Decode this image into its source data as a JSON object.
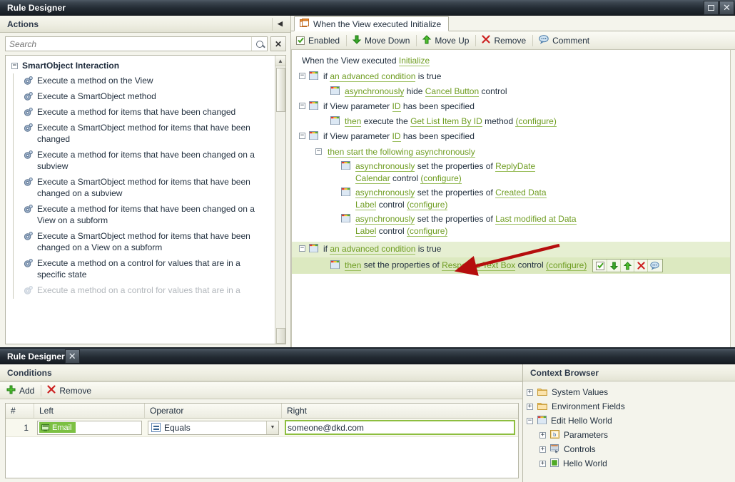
{
  "window": {
    "title": "Rule Designer",
    "maximize_icon": "maximize-icon",
    "close_icon": "close-icon"
  },
  "actions_panel": {
    "header": "Actions",
    "collapse_icon": "collapse-left-icon",
    "search": {
      "placeholder": "Search",
      "value": "",
      "search_icon": "search-icon",
      "clear_icon": "clear-icon"
    },
    "group": {
      "label": "SmartObject Interaction",
      "expander": "−"
    },
    "items": [
      {
        "label": "Execute a method on the View",
        "icon": "gear-icon"
      },
      {
        "label": "Execute a SmartObject method",
        "icon": "gear-icon"
      },
      {
        "label": "Execute a method for items that have been changed",
        "icon": "gear-icon"
      },
      {
        "label": "Execute a SmartObject method for items that have been changed",
        "icon": "gear-icon"
      },
      {
        "label": "Execute a method for items that have been changed on a subview",
        "icon": "gear-icon"
      },
      {
        "label": "Execute a SmartObject method for items that have been changed on a subview",
        "icon": "gear-icon"
      },
      {
        "label": "Execute a method for items that have been changed on a View on a subform",
        "icon": "gear-icon"
      },
      {
        "label": "Execute a SmartObject method for items that have been changed on a View on a subform",
        "icon": "gear-icon"
      },
      {
        "label": "Execute a method on a control for values that are in a specific state",
        "icon": "gear-icon"
      },
      {
        "label": "Execute a method on a control for values that are in a",
        "icon": "gear-icon"
      }
    ]
  },
  "rule_panel": {
    "tab": {
      "label": "When the View executed Initialize",
      "icon": "rule-tab-icon"
    },
    "toolbar": [
      {
        "label": "Enabled",
        "icon": "checkbox-checked-icon"
      },
      {
        "label": "Move Down",
        "icon": "arrow-down-icon"
      },
      {
        "label": "Move Up",
        "icon": "arrow-up-icon"
      },
      {
        "label": "Remove",
        "icon": "x-remove-icon"
      },
      {
        "label": "Comment",
        "icon": "comment-icon"
      }
    ],
    "heading": {
      "prefix": "When the View executed ",
      "link": "Initialize"
    },
    "nodes": [
      {
        "id": "n1",
        "expander": "−",
        "parts": [
          {
            "t": "if ",
            "k": "plain"
          },
          {
            "t": "an advanced condition",
            "k": "link"
          },
          {
            "t": " is true",
            "k": "plain"
          }
        ]
      },
      {
        "id": "n1c",
        "child": true,
        "parts": [
          {
            "t": "asynchronously",
            "k": "link"
          },
          {
            "t": " hide ",
            "k": "plain"
          },
          {
            "t": "Cancel Button",
            "k": "link"
          },
          {
            "t": " control",
            "k": "plain"
          }
        ]
      },
      {
        "id": "n2",
        "expander": "−",
        "parts": [
          {
            "t": "if View parameter ",
            "k": "plain"
          },
          {
            "t": "ID",
            "k": "link"
          },
          {
            "t": " has been specified",
            "k": "plain"
          }
        ]
      },
      {
        "id": "n2c",
        "child": true,
        "parts": [
          {
            "t": "then",
            "k": "link"
          },
          {
            "t": " execute the ",
            "k": "plain"
          },
          {
            "t": "Get List Item By ID",
            "k": "link"
          },
          {
            "t": " method  ",
            "k": "plain"
          },
          {
            "t": "(configure)",
            "k": "link"
          }
        ]
      },
      {
        "id": "n3",
        "expander": "−",
        "parts": [
          {
            "t": "if View parameter ",
            "k": "plain"
          },
          {
            "t": "ID",
            "k": "link"
          },
          {
            "t": " has been specified",
            "k": "plain"
          }
        ]
      }
    ],
    "async_group": {
      "expander": "−",
      "label": "then start the following asynchronously",
      "children": [
        {
          "parts": [
            {
              "t": "asynchronously",
              "k": "link"
            },
            {
              "t": " set the properties of ",
              "k": "plain"
            },
            {
              "t": "ReplyDate",
              "k": "link"
            }
          ],
          "line2": [
            {
              "t": "Calendar",
              "k": "link"
            },
            {
              "t": " control ",
              "k": "plain"
            },
            {
              "t": "(configure)",
              "k": "link"
            }
          ]
        },
        {
          "parts": [
            {
              "t": "asynchronously",
              "k": "link"
            },
            {
              "t": " set the properties of ",
              "k": "plain"
            },
            {
              "t": "Created Data",
              "k": "link"
            }
          ],
          "line2": [
            {
              "t": "Label",
              "k": "link"
            },
            {
              "t": " control ",
              "k": "plain"
            },
            {
              "t": "(configure)",
              "k": "link"
            }
          ]
        },
        {
          "parts": [
            {
              "t": "asynchronously",
              "k": "link"
            },
            {
              "t": " set the properties of ",
              "k": "plain"
            },
            {
              "t": "Last modified at Data",
              "k": "link"
            }
          ],
          "line2": [
            {
              "t": "Label",
              "k": "link"
            },
            {
              "t": " control ",
              "k": "plain"
            },
            {
              "t": "(configure)",
              "k": "link"
            }
          ]
        }
      ]
    },
    "selected_node": {
      "expander": "−",
      "parts": [
        {
          "t": "if ",
          "k": "plain"
        },
        {
          "t": "an advanced condition",
          "k": "link"
        },
        {
          "t": " is true",
          "k": "plain"
        }
      ],
      "child_parts": [
        {
          "t": "then",
          "k": "link"
        },
        {
          "t": " set the properties of ",
          "k": "plain"
        },
        {
          "t": "Response Text Box",
          "k": "link"
        },
        {
          "t": " control ",
          "k": "plain"
        },
        {
          "t": "(configure)",
          "k": "link"
        }
      ],
      "inline_tools": [
        {
          "icon": "checkbox-enabled-icon",
          "name": "enable-toggle"
        },
        {
          "icon": "arrow-down-icon",
          "name": "move-down"
        },
        {
          "icon": "arrow-up-icon",
          "name": "move-up"
        },
        {
          "icon": "x-remove-icon",
          "name": "remove"
        },
        {
          "icon": "comment-icon",
          "name": "comment"
        }
      ]
    },
    "annotation": {
      "type": "arrow",
      "color": "#b50d0d"
    }
  },
  "bottom": {
    "title": "Rule Designer",
    "close_icon": "close-icon",
    "conditions": {
      "header": "Conditions",
      "toolbar": [
        {
          "label": "Add",
          "icon": "plus-icon"
        },
        {
          "label": "Remove",
          "icon": "x-remove-icon"
        }
      ],
      "columns": [
        "#",
        "Left",
        "Operator",
        "Right"
      ],
      "rows": [
        {
          "num": "1",
          "left": "Email",
          "left_icon": "field-token-icon",
          "operator": "Equals",
          "operator_icon": "equals-icon",
          "right": "someone@dkd.com"
        }
      ]
    },
    "context_browser": {
      "header": "Context Browser",
      "nodes": [
        {
          "label": "System Values",
          "expander": "+",
          "icon": "folder-icon",
          "depth": 0
        },
        {
          "label": "Environment Fields",
          "expander": "+",
          "icon": "folder-icon",
          "depth": 0
        },
        {
          "label": "Edit Hello World",
          "expander": "−",
          "icon": "view-icon",
          "depth": 0
        },
        {
          "label": "Parameters",
          "expander": "+",
          "icon": "parameters-icon",
          "depth": 1
        },
        {
          "label": "Controls",
          "expander": "+",
          "icon": "controls-icon",
          "depth": 1
        },
        {
          "label": "Hello World",
          "expander": "+",
          "icon": "smartobject-icon",
          "depth": 1
        }
      ]
    }
  },
  "colors": {
    "link_green": "#6f9d22",
    "highlight_row": "#e6efd2",
    "annotation_red": "#b50d0d",
    "titlebar_dark": "#232b33",
    "token_green": "#7cc043"
  }
}
